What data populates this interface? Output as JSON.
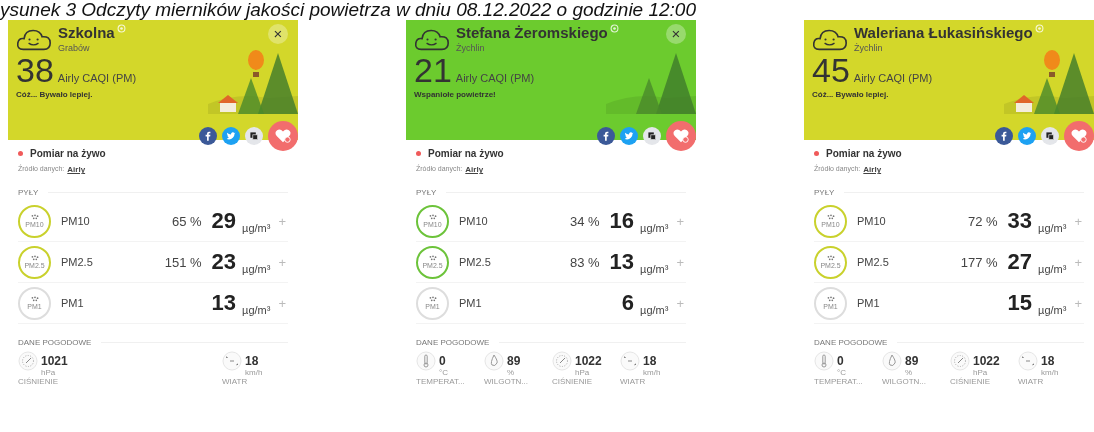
{
  "caption": "ysunek 3 Odczyty mierników jakości powietrza w dniu 08.12.2022 o godzinie 12:00",
  "panels": [
    {
      "color": "#d3d72a",
      "balloon": true,
      "close": "×",
      "title": "Szkolna",
      "city": "Grabów",
      "caqi": "38",
      "caqi_label": "Airly CAQI (PM)",
      "message": "Cóż... Bywało lepiej.",
      "live": "Pomiar na żywo",
      "source_label": "Źródło danych:",
      "source_link": "Airly",
      "pm_heading": "PYŁY",
      "pollutants": [
        {
          "icon_label": "PM10",
          "name": "PM10",
          "percent": "65 %",
          "value": "29",
          "unit": "µg/m³",
          "plus": "+",
          "color": "#c9d12c"
        },
        {
          "icon_label": "PM2.5",
          "name": "PM2.5",
          "percent": "151 %",
          "value": "23",
          "unit": "µg/m³",
          "plus": "+",
          "color": "#c9d12c"
        },
        {
          "icon_label": "PM1",
          "name": "PM1",
          "value": "13",
          "unit": "µg/m³",
          "plus": "+",
          "color": "#dddddd"
        }
      ],
      "weather_heading": "DANE POGODOWE",
      "weather": [
        {
          "kind": "pressure",
          "value": "1021",
          "unit": "hPa",
          "label": "CIŚNIENIE"
        },
        {
          "kind": "spacer"
        },
        {
          "kind": "spacer"
        },
        {
          "kind": "wind",
          "value": "18",
          "unit": "km/h",
          "label": "WIATR"
        }
      ]
    },
    {
      "color": "#6ccb2e",
      "balloon": false,
      "close": "×",
      "title": "Stefana Żeromskiego",
      "city": "Żychlin",
      "caqi": "21",
      "caqi_label": "Airly CAQI (PM)",
      "message": "Wspaniołe powietrze!",
      "live": "Pomiar na żywo",
      "source_label": "Źródło danych:",
      "source_link": "Airly",
      "pm_heading": "PYŁY",
      "pollutants": [
        {
          "icon_label": "PM10",
          "name": "PM10",
          "percent": "34 %",
          "value": "16",
          "unit": "µg/m³",
          "plus": "+",
          "color": "#6cc33a"
        },
        {
          "icon_label": "PM2.5",
          "name": "PM2.5",
          "percent": "83 %",
          "value": "13",
          "unit": "µg/m³",
          "plus": "+",
          "color": "#6cc33a"
        },
        {
          "icon_label": "PM1",
          "name": "PM1",
          "value": "6",
          "unit": "µg/m³",
          "plus": "+",
          "color": "#dddddd"
        }
      ],
      "weather_heading": "DANE POGODOWE",
      "weather": [
        {
          "kind": "temperature",
          "value": "0",
          "unit": "°C",
          "label": "TEMPERAT..."
        },
        {
          "kind": "humidity",
          "value": "89",
          "unit": "%",
          "label": "WILGOTN..."
        },
        {
          "kind": "pressure",
          "value": "1022",
          "unit": "hPa",
          "label": "CIŚNIENIE"
        },
        {
          "kind": "wind",
          "value": "18",
          "unit": "km/h",
          "label": "WIATR"
        }
      ]
    },
    {
      "color": "#d3d72a",
      "balloon": true,
      "title": "Waleriana Łukasińskiego",
      "city": "Żychlin",
      "caqi": "45",
      "caqi_label": "Airly CAQI (PM)",
      "message": "Cóż... Bywało lepiej.",
      "live": "Pomiar na żywo",
      "source_label": "Źródło danych:",
      "source_link": "Airly",
      "pm_heading": "PYŁY",
      "pollutants": [
        {
          "icon_label": "PM10",
          "name": "PM10",
          "percent": "72 %",
          "value": "33",
          "unit": "µg/m³",
          "plus": "+",
          "color": "#c9d12c"
        },
        {
          "icon_label": "PM2.5",
          "name": "PM2.5",
          "percent": "177 %",
          "value": "27",
          "unit": "µg/m³",
          "plus": "+",
          "color": "#c9d12c"
        },
        {
          "icon_label": "PM1",
          "name": "PM1",
          "value": "15",
          "unit": "µg/m³",
          "plus": "+",
          "color": "#dddddd"
        }
      ],
      "weather_heading": "DANE POGODOWE",
      "weather": [
        {
          "kind": "temperature",
          "value": "0",
          "unit": "°C",
          "label": "TEMPERAT..."
        },
        {
          "kind": "humidity",
          "value": "89",
          "unit": "%",
          "label": "WILGOTN..."
        },
        {
          "kind": "pressure",
          "value": "1022",
          "unit": "hPa",
          "label": "CIŚNIENIE"
        },
        {
          "kind": "wind",
          "value": "18",
          "unit": "km/h",
          "label": "WIATR"
        }
      ]
    }
  ]
}
